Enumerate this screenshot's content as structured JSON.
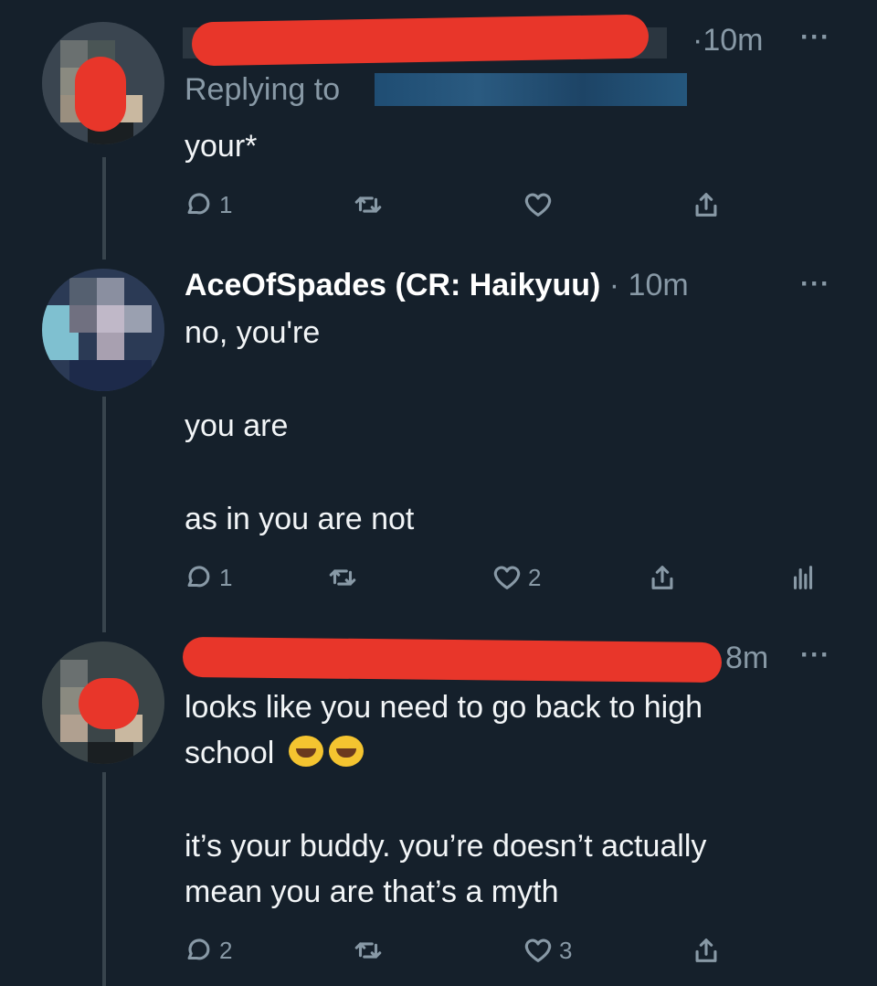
{
  "tweets": [
    {
      "time": "·10m",
      "replying_label": "Replying to",
      "text": "your*",
      "actions": {
        "reply_count": "1",
        "retweet_count": "",
        "like_count": ""
      }
    },
    {
      "name": "AceOfSpades (CR: Haikyuu)",
      "time": "· 10m",
      "line1": "no, you're",
      "line2": "you are",
      "line3": "as in you are not",
      "actions": {
        "reply_count": "1",
        "retweet_count": "",
        "like_count": "2"
      }
    },
    {
      "time": "8m",
      "line1": "looks like you need to go back to high",
      "line2": "school",
      "line3": "it’s your buddy. you’re doesn’t actually",
      "line4": "mean you are that’s a myth",
      "actions": {
        "reply_count": "2",
        "retweet_count": "",
        "like_count": "3"
      }
    }
  ],
  "icons": {
    "reply": "reply-icon",
    "retweet": "retweet-icon",
    "like": "heart-icon",
    "share": "share-icon",
    "analytics": "analytics-icon",
    "more": "more-icon"
  },
  "colors": {
    "background": "#15202b",
    "muted": "#8899a6",
    "redaction": "#e8362a"
  }
}
